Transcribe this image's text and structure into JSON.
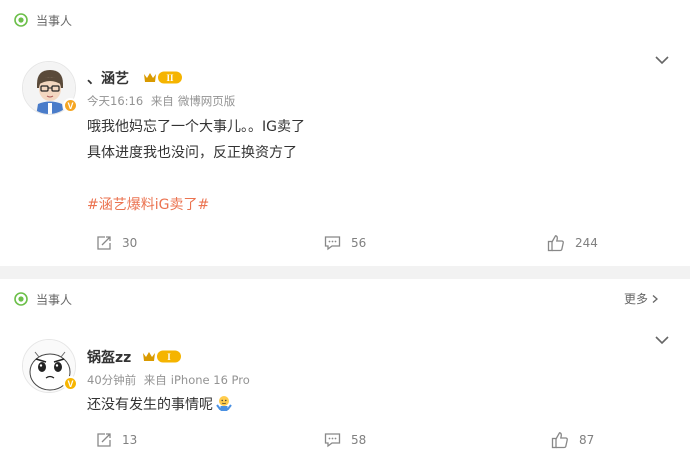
{
  "posts": [
    {
      "topic_label": "当事人",
      "username": "、涵艺",
      "level_badge": "II",
      "verify_mark": "V",
      "time": "今天16:16",
      "source_prefix": "来自",
      "source": "微博网页版",
      "lines": [
        "哦我他妈忘了一个大事儿。。IG卖了",
        "具体进度我也没问，反正换资方了"
      ],
      "hashtag": "#涵艺爆料iG卖了#",
      "reposts": "30",
      "comments": "56",
      "likes": "244"
    },
    {
      "topic_label": "当事人",
      "more_label": "更多",
      "username": "锅盔zz",
      "level_badge": "I",
      "verify_mark": "V",
      "time": "40分钟前",
      "source_prefix": "来自",
      "source": "iPhone 16 Pro",
      "text": "还没有发生的事情呢",
      "reposts": "13",
      "comments": "58",
      "likes": "87"
    }
  ],
  "colors": {
    "hashtag": "#eb7350",
    "verify_orange": "#f5a623",
    "verify_yellow": "#f7b500",
    "topic_green": "#6cbf4a"
  }
}
